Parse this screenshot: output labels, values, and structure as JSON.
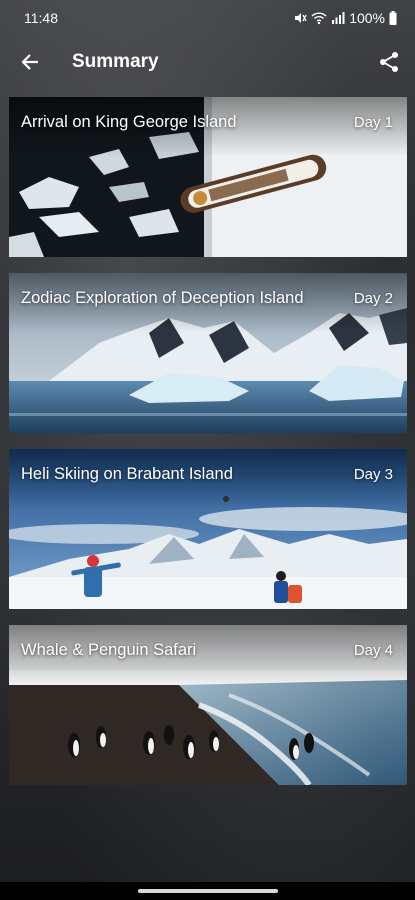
{
  "status_bar": {
    "time": "11:48",
    "battery": "100%",
    "icons": [
      "mute-icon",
      "wifi-icon",
      "signal-icon",
      "battery-icon"
    ]
  },
  "app_bar": {
    "title": "Summary",
    "back_icon": "arrow-back-icon",
    "share_icon": "share-icon"
  },
  "days": [
    {
      "title": "Arrival on King George Island",
      "day": "Day 1",
      "image": "ship-in-ice-floe"
    },
    {
      "title": "Zodiac Exploration of Deception Island",
      "day": "Day 2",
      "image": "snowy-mountains-icebergs"
    },
    {
      "title": "Heli Skiing on Brabant Island",
      "day": "Day 3",
      "image": "skiers-snowy-peaks"
    },
    {
      "title": "Whale & Penguin Safari",
      "day": "Day 4",
      "image": "penguins-on-beach"
    }
  ],
  "colors": {
    "text": "#ffffff",
    "nav_bar": "#000000"
  }
}
